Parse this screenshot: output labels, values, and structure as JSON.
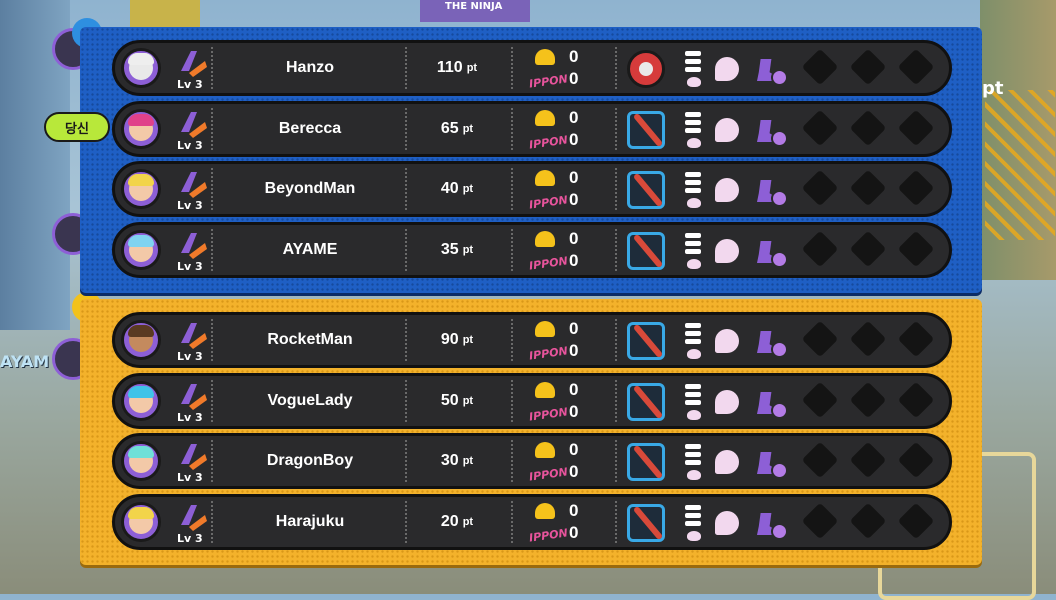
{
  "background": {
    "sign_text": "THE NINJA",
    "pt_text": "pt",
    "side_name": "AYAM"
  },
  "you_label": "당신",
  "labels": {
    "ko_label": "IPPON",
    "pt_unit": "pt",
    "level": "Lv 3"
  },
  "teams": [
    {
      "name": "blue",
      "color": "#1f5fc4",
      "players": [
        {
          "name": "Hanzo",
          "points": "110",
          "level": "Lv 3",
          "kos": "0",
          "ippon": "0",
          "weapon": "yoyo-icon",
          "hair": "#eeeeee",
          "face": "#e9e9e9",
          "ring": "#8d5fd6"
        },
        {
          "name": "Berecca",
          "points": "65",
          "level": "Lv 3",
          "kos": "0",
          "ippon": "0",
          "weapon": "stick-icon",
          "hair": "#e0418a",
          "face": "#f3c9a8",
          "ring": "#8d5fd6"
        },
        {
          "name": "BeyondMan",
          "points": "40",
          "level": "Lv 3",
          "kos": "0",
          "ippon": "0",
          "weapon": "stick-icon",
          "hair": "#f2d44a",
          "face": "#f3c9a8",
          "ring": "#8d5fd6"
        },
        {
          "name": "AYAME",
          "points": "35",
          "level": "Lv 3",
          "kos": "0",
          "ippon": "0",
          "weapon": "stick-icon",
          "hair": "#7fd3f0",
          "face": "#f3c9a8",
          "ring": "#8d5fd6"
        }
      ]
    },
    {
      "name": "yellow",
      "color": "#f3b22b",
      "players": [
        {
          "name": "RocketMan",
          "points": "90",
          "level": "Lv 3",
          "kos": "0",
          "ippon": "0",
          "weapon": "stick-icon",
          "hair": "#5a3a22",
          "face": "#c48a5e",
          "ring": "#8d5fd6"
        },
        {
          "name": "VogueLady",
          "points": "50",
          "level": "Lv 3",
          "kos": "0",
          "ippon": "0",
          "weapon": "stick-icon",
          "hair": "#3fc3e8",
          "face": "#f3c9a8",
          "ring": "#8d5fd6"
        },
        {
          "name": "DragonBoy",
          "points": "30",
          "level": "Lv 3",
          "kos": "0",
          "ippon": "0",
          "weapon": "stick-icon",
          "hair": "#6fe0d8",
          "face": "#f3c9a8",
          "ring": "#8d5fd6"
        },
        {
          "name": "Harajuku",
          "points": "20",
          "level": "Lv 3",
          "kos": "0",
          "ippon": "0",
          "weapon": "stick-icon",
          "hair": "#f2d44a",
          "face": "#f3c9a8",
          "ring": "#8d5fd6"
        }
      ]
    }
  ]
}
